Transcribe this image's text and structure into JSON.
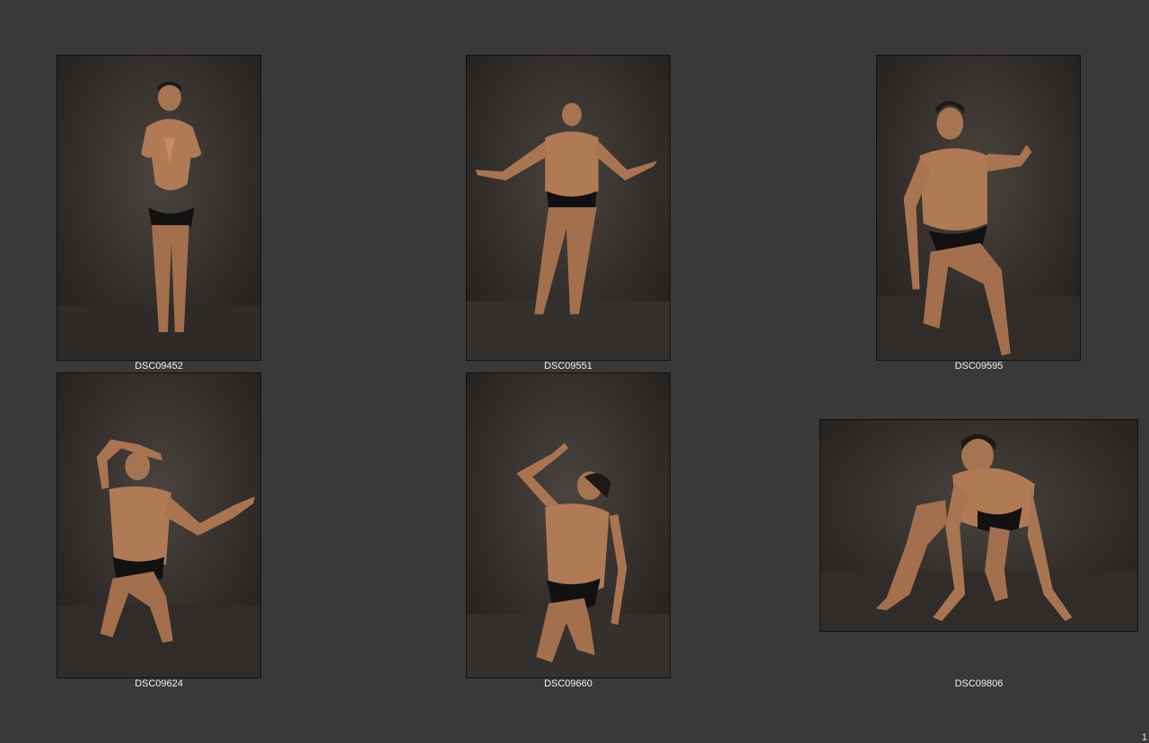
{
  "contact_sheet": {
    "thumbnails": [
      {
        "caption": "DSC09452",
        "orientation": "portrait",
        "pose": "standing-prayer-hands"
      },
      {
        "caption": "DSC09551",
        "orientation": "portrait",
        "pose": "standing-arms-open-head-back"
      },
      {
        "caption": "DSC09595",
        "orientation": "portrait",
        "pose": "kneeling-one-knee-arm-raised"
      },
      {
        "caption": "DSC09624",
        "orientation": "portrait",
        "pose": "kneeling-arm-over-head"
      },
      {
        "caption": "DSC09660",
        "orientation": "portrait",
        "pose": "kneeling-looking-up"
      },
      {
        "caption": "DSC09806",
        "orientation": "landscape",
        "pose": "crouching-on-all-fours"
      }
    ],
    "page_number": "1"
  },
  "colors": {
    "background": "#393939",
    "photo_backdrop": "#3a3532",
    "skin": "#b07a55",
    "briefs": "#111111"
  }
}
